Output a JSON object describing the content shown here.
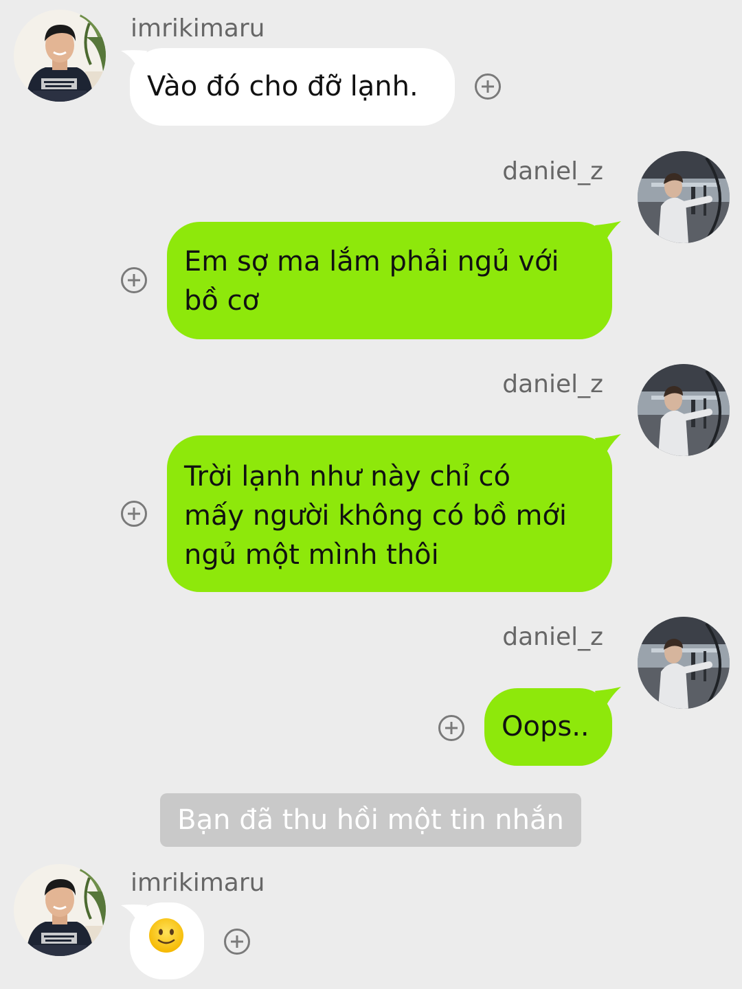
{
  "messages": [
    {
      "sender": "imrikimaru",
      "direction": "incoming",
      "lines": [
        "Vào đó cho đỡ lạnh."
      ]
    },
    {
      "sender": "daniel_z",
      "direction": "outgoing",
      "lines": [
        "Em sợ ma lắm phải ngủ với",
        "bồ cơ"
      ]
    },
    {
      "sender": "daniel_z",
      "direction": "outgoing",
      "lines": [
        "Trời lạnh như này chỉ có",
        "mấy người không có bồ mới",
        "ngủ một mình thôi"
      ]
    },
    {
      "sender": "daniel_z",
      "direction": "outgoing",
      "lines": [
        "Oops.."
      ]
    },
    {
      "sender": "imrikimaru",
      "direction": "incoming",
      "sticker": "slightly-smiling-face-emoji"
    }
  ],
  "system_notice": "Bạn đã thu hồi một tin nhắn",
  "colors": {
    "background": "#ececec",
    "incoming_bubble": "#ffffff",
    "outgoing_bubble": "#8ee80b",
    "system_notice_bg": "#c9c9c9",
    "sender_name": "#666666"
  },
  "icons": {
    "add_reaction": "plus-circle-icon"
  }
}
